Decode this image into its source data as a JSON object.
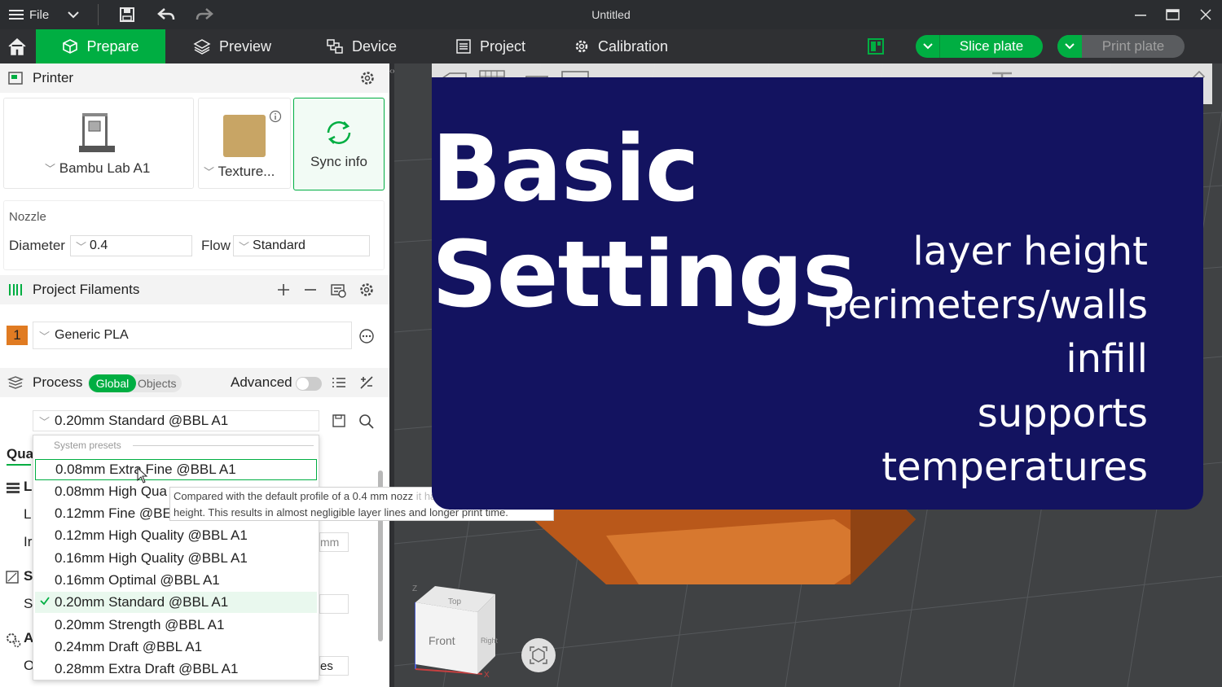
{
  "titlebar": {
    "file_label": "File",
    "title": "Untitled"
  },
  "nav": {
    "prepare": "Prepare",
    "preview": "Preview",
    "device": "Device",
    "project": "Project",
    "calibration": "Calibration",
    "slice": "Slice plate",
    "print": "Print plate"
  },
  "printer": {
    "heading": "Printer",
    "printer_name": "Bambu Lab A1",
    "plate_name": "Texture...",
    "sync_label": "Sync info"
  },
  "nozzle": {
    "heading": "Nozzle",
    "diameter_label": "Diameter",
    "diameter_value": "0.4",
    "flow_label": "Flow",
    "flow_value": "Standard"
  },
  "filaments": {
    "heading": "Project Filaments",
    "slot": "1",
    "name": "Generic PLA"
  },
  "process": {
    "heading": "Process",
    "tab_global": "Global",
    "tab_objects": "Objects",
    "advanced_label": "Advanced",
    "preset": "0.20mm Standard @BBL A1"
  },
  "side_fragments": {
    "qua": "Qua",
    "l": "L",
    "l2": "L",
    "ir": "Ir",
    "s": "S",
    "s2": "S",
    "a": "A",
    "o": "O",
    "mm": "mm",
    "es": "es"
  },
  "dropdown": {
    "group_label": "System presets",
    "items": [
      "0.08mm Extra Fine @BBL A1",
      "0.08mm High Qua",
      "0.12mm Fine @BE",
      "0.12mm High Quality @BBL A1",
      "0.16mm High Quality @BBL A1",
      "0.16mm Optimal @BBL A1",
      "0.20mm Standard @BBL A1",
      "0.20mm Strength @BBL A1",
      "0.24mm Draft @BBL A1",
      "0.28mm Extra Draft @BBL A1"
    ],
    "selected_index": 6,
    "hover_index": 0
  },
  "tooltip": {
    "line1": "Compared with the default profile of a 0.4 mm nozz",
    "line1_faded": "it has a smaller layer",
    "line2": "height. This results in almost negligible layer lines and longer print time."
  },
  "overlay": {
    "title": "Basic Settings",
    "lines": [
      "layer height",
      "perimeters/walls",
      "infill",
      "supports",
      "temperatures"
    ]
  },
  "viewcube": {
    "front": "Front",
    "top": "Top",
    "right": "Right",
    "z_axis": "Z",
    "x_axis": "X"
  },
  "colors": {
    "accent": "#00ae42",
    "overlay_bg": "#131360",
    "model": "#c8651f",
    "filament_slot": "#e07b22"
  }
}
